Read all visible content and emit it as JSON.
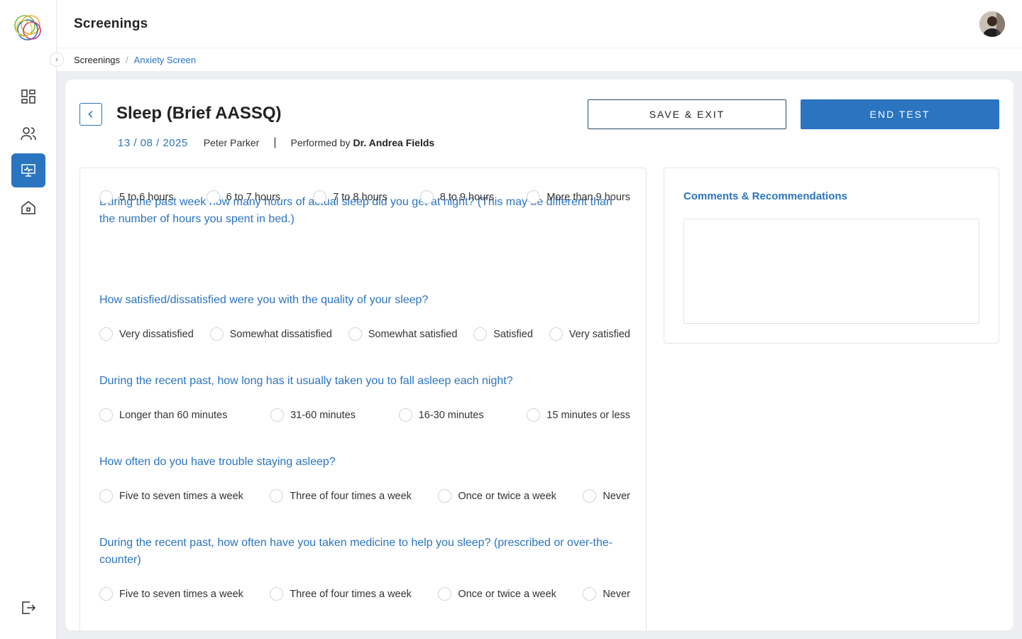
{
  "topbar": {
    "title": "Screenings"
  },
  "breadcrumb": {
    "root": "Screenings",
    "separator": "/",
    "current": "Anxiety Screen"
  },
  "sidebar": {
    "items": [
      {
        "icon": "dashboard-icon"
      },
      {
        "icon": "users-icon"
      },
      {
        "icon": "screening-monitor-icon",
        "active": true
      },
      {
        "icon": "home-icon"
      }
    ],
    "logout_icon": "logout-icon"
  },
  "test": {
    "title": "Sleep (Brief AASSQ)",
    "date": "13 / 08 / 2025",
    "patient": "Peter Parker",
    "divider": "|",
    "performed_by_label": "Performed by",
    "doctor": "Dr. Andrea Fields"
  },
  "actions": {
    "save_exit": "SAVE & EXIT",
    "end_test": "END TEST"
  },
  "questions": [
    {
      "text": "During the past week how many hours of actual sleep did you get at night? (This may be different than the number of hours you spent in bed.)",
      "options": [
        "5 to 6 hours",
        "6 to 7 hours",
        "7 to 8 hours",
        "8 to 9 hours",
        "More than 9 hours"
      ]
    },
    {
      "text": "How satisfied/dissatisfied were you with the quality of your sleep?",
      "options": [
        "Very dissatisfied",
        "Somewhat dissatisfied",
        "Somewhat satisfied",
        "Satisfied",
        "Very satisfied"
      ]
    },
    {
      "text": "During the recent past, how long has it usually taken you to fall asleep each night?",
      "options": [
        "Longer than 60 minutes",
        "31-60 minutes",
        "16-30 minutes",
        "15 minutes or less"
      ]
    },
    {
      "text": "How often do you have trouble staying asleep?",
      "options": [
        "Five to seven times a week",
        "Three of four times a week",
        "Once or twice a week",
        "Never"
      ]
    },
    {
      "text": "During the recent past, how often have you taken medicine to help you sleep? (prescribed or over-the-counter)",
      "options": [
        "Five to seven times a week",
        "Three of four times a week",
        "Once or twice a week",
        "Never"
      ]
    }
  ],
  "comments": {
    "label": "Comments & Recommendations",
    "value": ""
  },
  "colors": {
    "accent": "#2a74c0",
    "background": "#eceef1"
  }
}
